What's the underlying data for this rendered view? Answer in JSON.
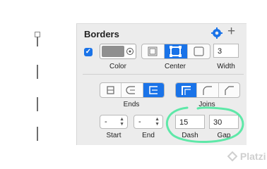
{
  "panel": {
    "title": "Borders",
    "labels": {
      "color": "Color",
      "position": "Center",
      "width": "Width",
      "ends": "Ends",
      "joins": "Joins",
      "start": "Start",
      "end": "End",
      "dash": "Dash",
      "gap": "Gap"
    },
    "values": {
      "width": "3",
      "start": "-",
      "end": "-",
      "dash": "15",
      "gap": "30"
    },
    "enabled": true,
    "border_color": "#8f8f8f",
    "accent": "#1a73e8",
    "position_selected": "Center",
    "ends_selected": 2,
    "joins_selected": 0
  },
  "annotation_color": "#5ee8a8",
  "watermark": "Platzi"
}
